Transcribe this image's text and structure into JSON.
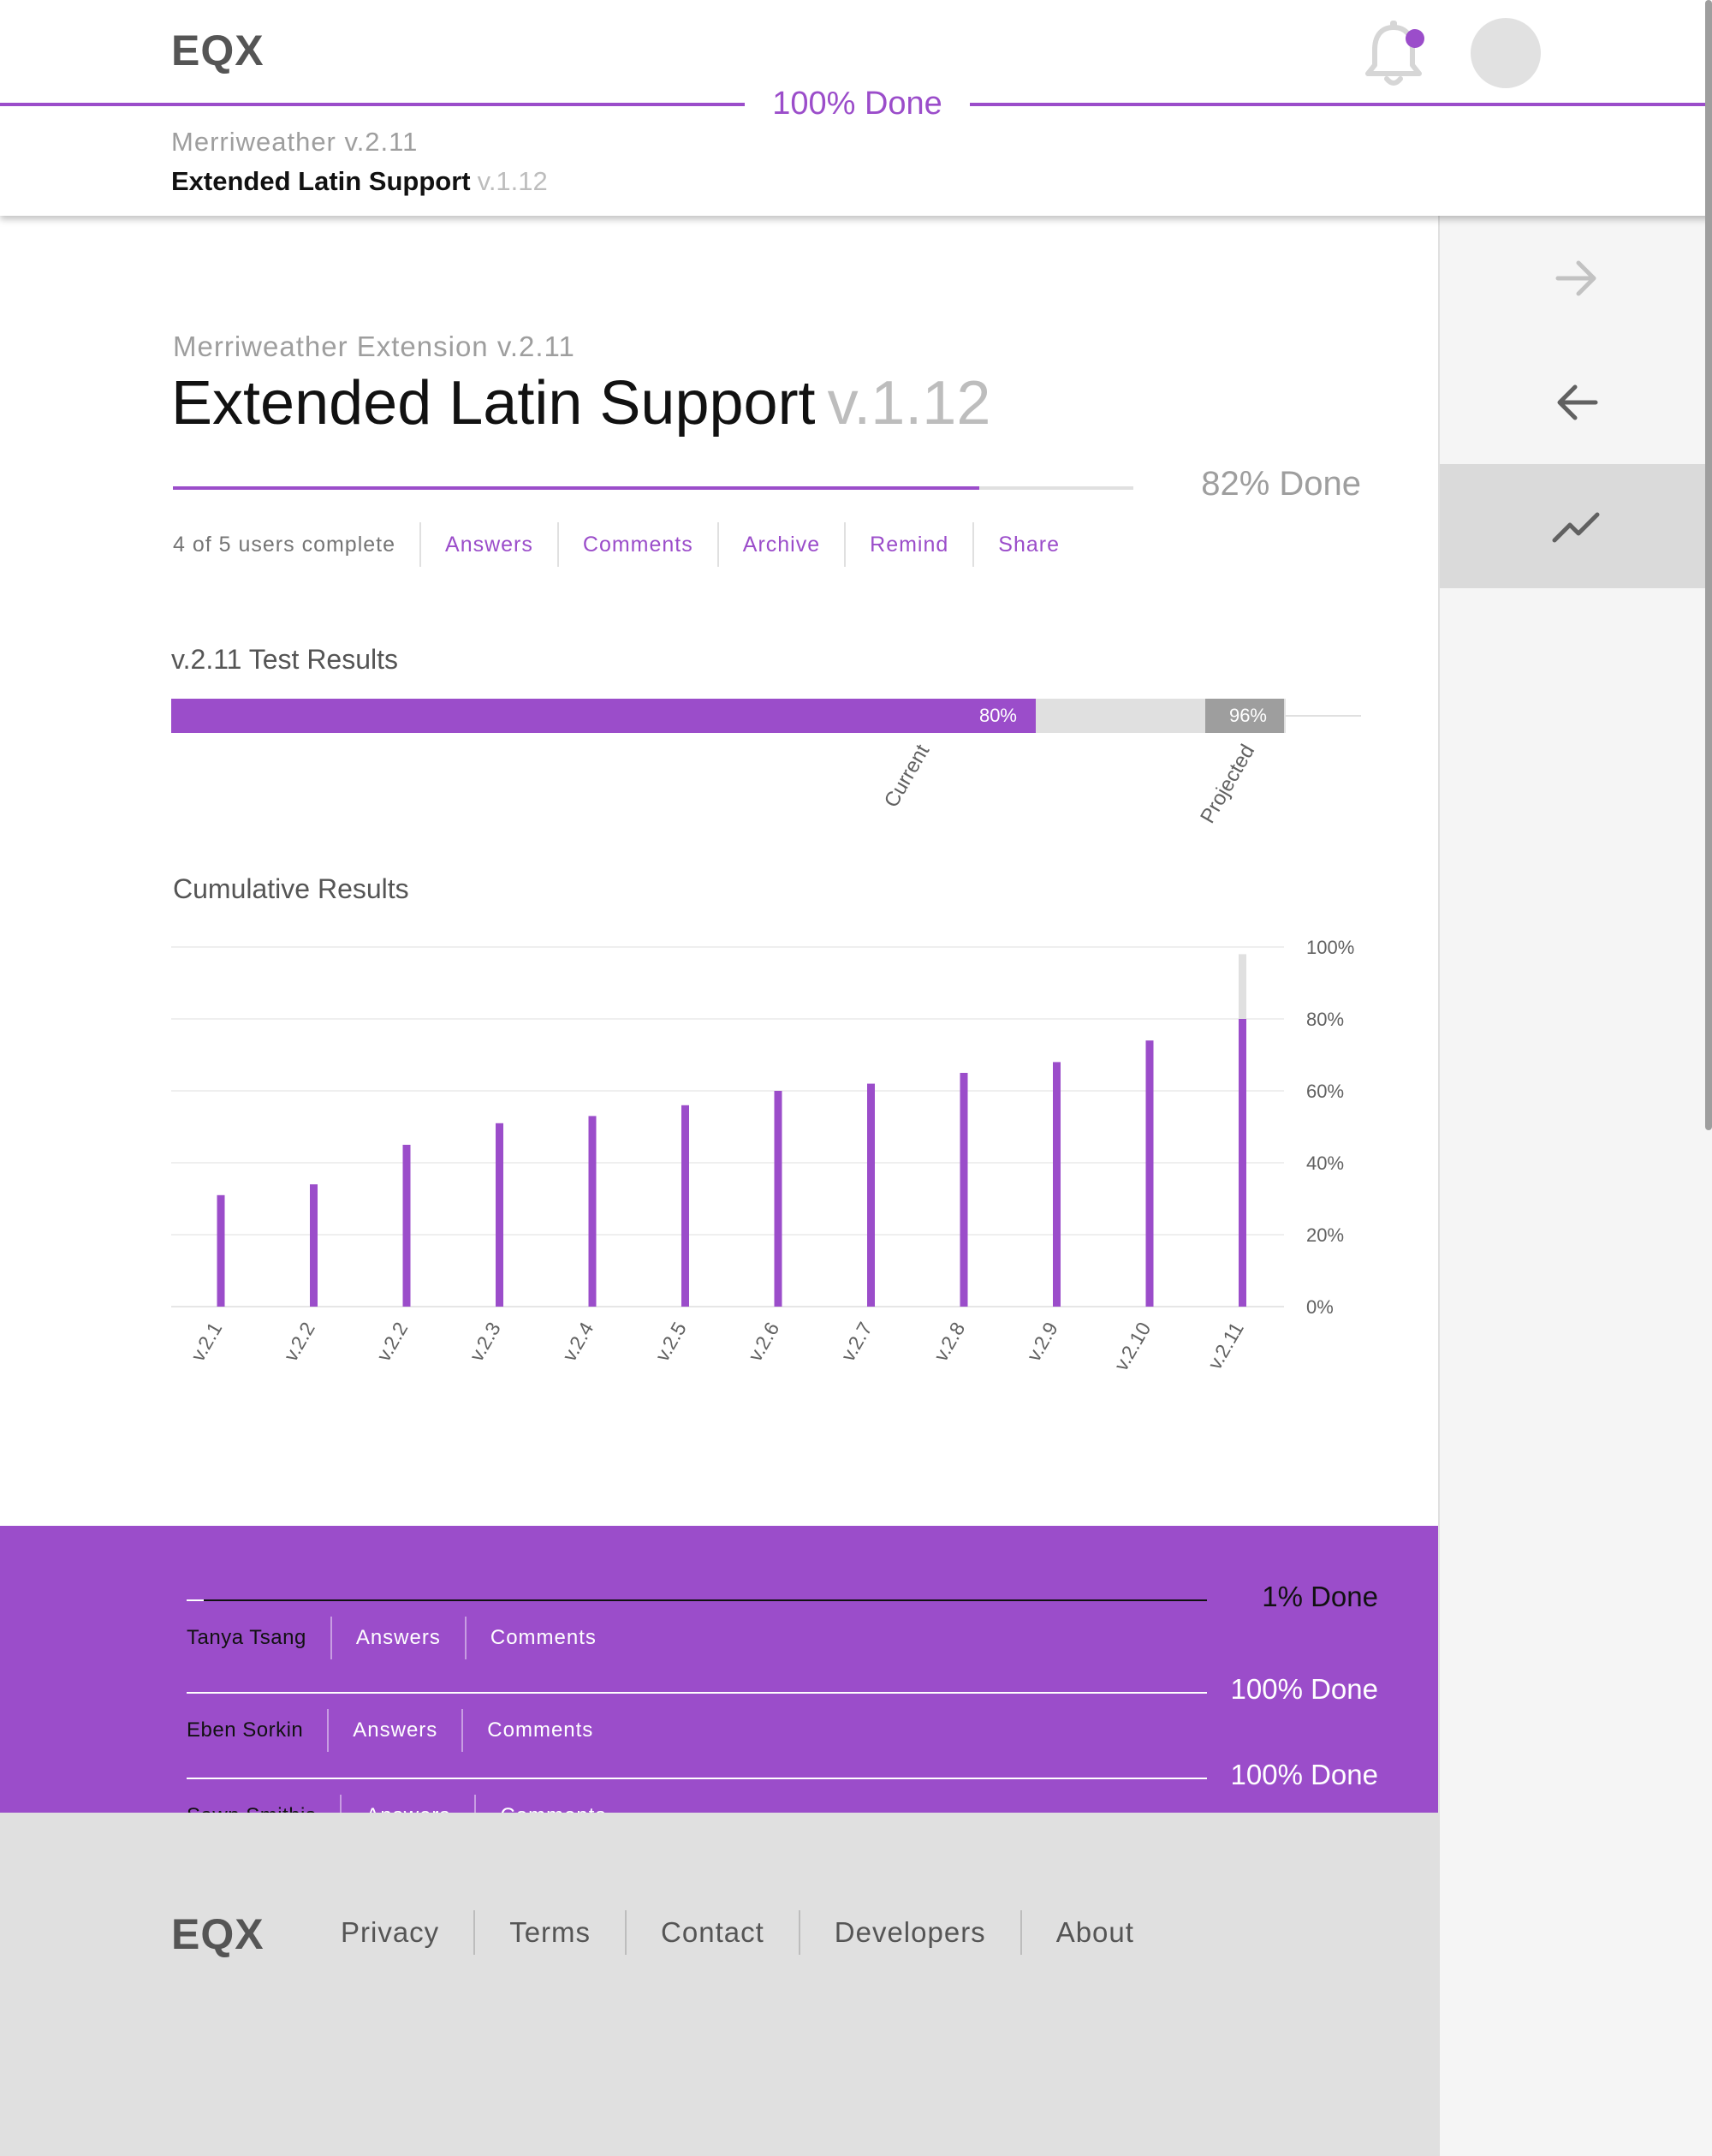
{
  "brand": {
    "logo": "EQX"
  },
  "header": {
    "overall_progress": 100,
    "overall_label": "100% Done",
    "parent": "Merriweather v.2.11",
    "title": "Extended Latin Support",
    "version": "v.1.12"
  },
  "sidebar": {
    "items": [
      "arrow-forward-icon",
      "arrow-back-icon",
      "trending-icon"
    ]
  },
  "main": {
    "parent": "Merriweather Extension v.2.11",
    "title": "Extended Latin Support",
    "version": "v.1.12",
    "progress": 84,
    "done_label": "82% Done",
    "users_complete": "4 of 5 users complete",
    "actions": [
      "Answers",
      "Comments",
      "Archive",
      "Remind",
      "Share"
    ]
  },
  "test_results": {
    "title": "v.2.11 Test Results",
    "current": 80,
    "current_label": "80%",
    "current_name": "Current",
    "projected": 96,
    "projected_label": "96%",
    "projected_name": "Projected"
  },
  "cumulative": {
    "title": "Cumulative Results"
  },
  "chart_data": {
    "type": "bar",
    "title": "Cumulative Results",
    "categories": [
      "v.2.1",
      "v.2.2",
      "v.2.2",
      "v.2.3",
      "v.2.4",
      "v.2.5",
      "v.2.6",
      "v.2.7",
      "v.2.8",
      "v.2.9",
      "v.2.10",
      "v.2.11"
    ],
    "values": [
      31,
      34,
      45,
      51,
      53,
      56,
      60,
      62,
      65,
      68,
      74,
      80
    ],
    "projected": [
      null,
      null,
      null,
      null,
      null,
      null,
      null,
      null,
      null,
      null,
      null,
      98
    ],
    "yticks": [
      "0%",
      "20%",
      "40%",
      "60%",
      "80%",
      "100%"
    ],
    "ylim": [
      0,
      100
    ],
    "grid": true,
    "bar_color": "#9b4dca",
    "projected_color": "#e0e0e0"
  },
  "users": [
    {
      "name": "Tanya Tsang",
      "progress": 1,
      "done_label": "1% Done",
      "actions": [
        "Answers",
        "Comments"
      ]
    },
    {
      "name": "Eben Sorkin",
      "progress": 100,
      "done_label": "100% Done",
      "actions": [
        "Answers",
        "Comments"
      ]
    },
    {
      "name": "Sawn Smithis",
      "progress": 100,
      "done_label": "100% Done",
      "actions": [
        "Answers",
        "Comments"
      ]
    }
  ],
  "footer": {
    "logo": "EQX",
    "links": [
      "Privacy",
      "Terms",
      "Contact",
      "Developers",
      "About"
    ]
  },
  "colors": {
    "accent": "#9b4dca",
    "muted_text": "#9e9e9e",
    "track": "#e0e0e0",
    "footer_bg": "#e0e0e0",
    "sidebar_bg": "#f5f5f5",
    "sidebar_active": "#dadada"
  }
}
